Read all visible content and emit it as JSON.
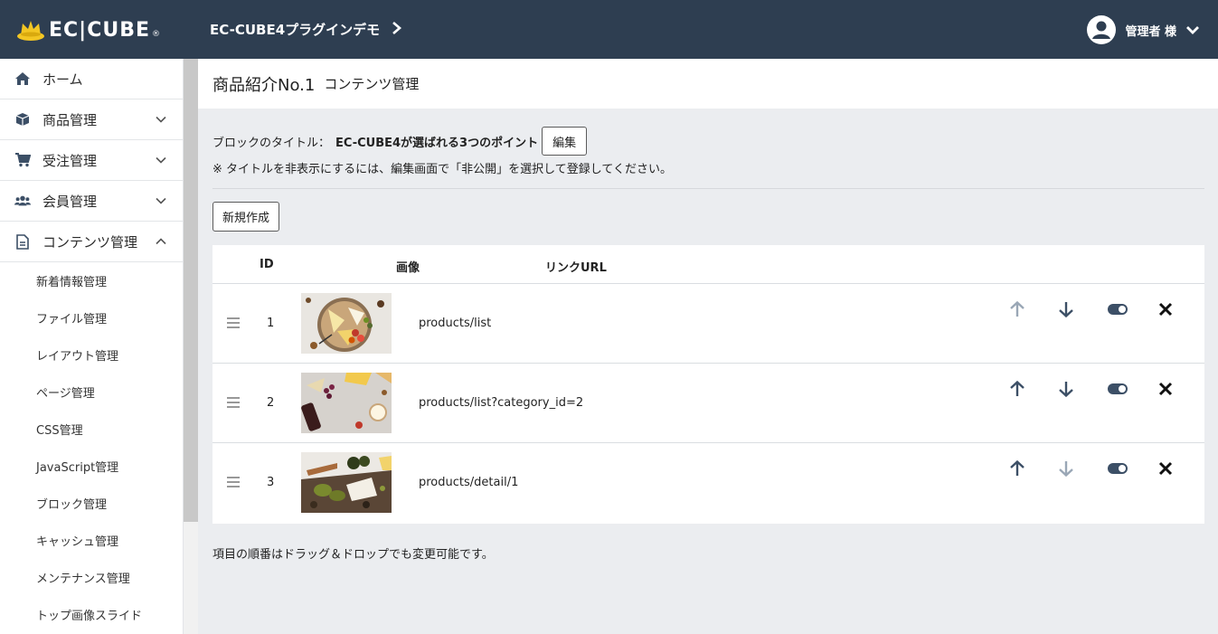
{
  "header": {
    "logo_text": "EC|CUBE",
    "logo_reg": "®",
    "shop_name": "EC-CUBE4プラグインデモ",
    "user_name": "管理者 様"
  },
  "sidebar": {
    "items": [
      {
        "label": "ホーム",
        "icon": "home-icon"
      },
      {
        "label": "商品管理",
        "icon": "box-icon",
        "caret": "down"
      },
      {
        "label": "受注管理",
        "icon": "cart-icon",
        "caret": "down"
      },
      {
        "label": "会員管理",
        "icon": "users-icon",
        "caret": "down"
      },
      {
        "label": "コンテンツ管理",
        "icon": "file-icon",
        "caret": "up"
      }
    ],
    "sub_items": [
      "新着情報管理",
      "ファイル管理",
      "レイアウト管理",
      "ページ管理",
      "CSS管理",
      "JavaScript管理",
      "ブロック管理",
      "キャッシュ管理",
      "メンテナンス管理",
      "トップ画像スライド"
    ]
  },
  "main": {
    "title": "商品紹介No.1",
    "subtitle": "コンテンツ管理",
    "block_title_label": "ブロックのタイトル：",
    "block_title_value": "EC-CUBE4が選ばれる3つのポイント",
    "edit_label": "編集",
    "note": "※ タイトルを非表示にするには、編集画面で「非公開」を選択して登録してください。",
    "new_label": "新規作成",
    "columns": {
      "id": "ID",
      "image": "画像",
      "url": "リンクURL"
    },
    "rows": [
      {
        "id": "1",
        "url": "products/list",
        "image": "cheese-platter-image",
        "up_disabled": true,
        "down_disabled": false
      },
      {
        "id": "2",
        "url": "products/list?category_id=2",
        "image": "wine-cheese-image",
        "up_disabled": false,
        "down_disabled": false
      },
      {
        "id": "3",
        "url": "products/detail/1",
        "image": "olives-cheese-image",
        "up_disabled": false,
        "down_disabled": true
      }
    ],
    "footer_note": "項目の順番はドラッグ＆ドロップでも変更可能です。"
  },
  "colors": {
    "header_bg": "#2e3e51",
    "active_icon": "#3c4f66",
    "disabled_icon": "#9aa7b6",
    "logo_gold": "#f3c623"
  }
}
